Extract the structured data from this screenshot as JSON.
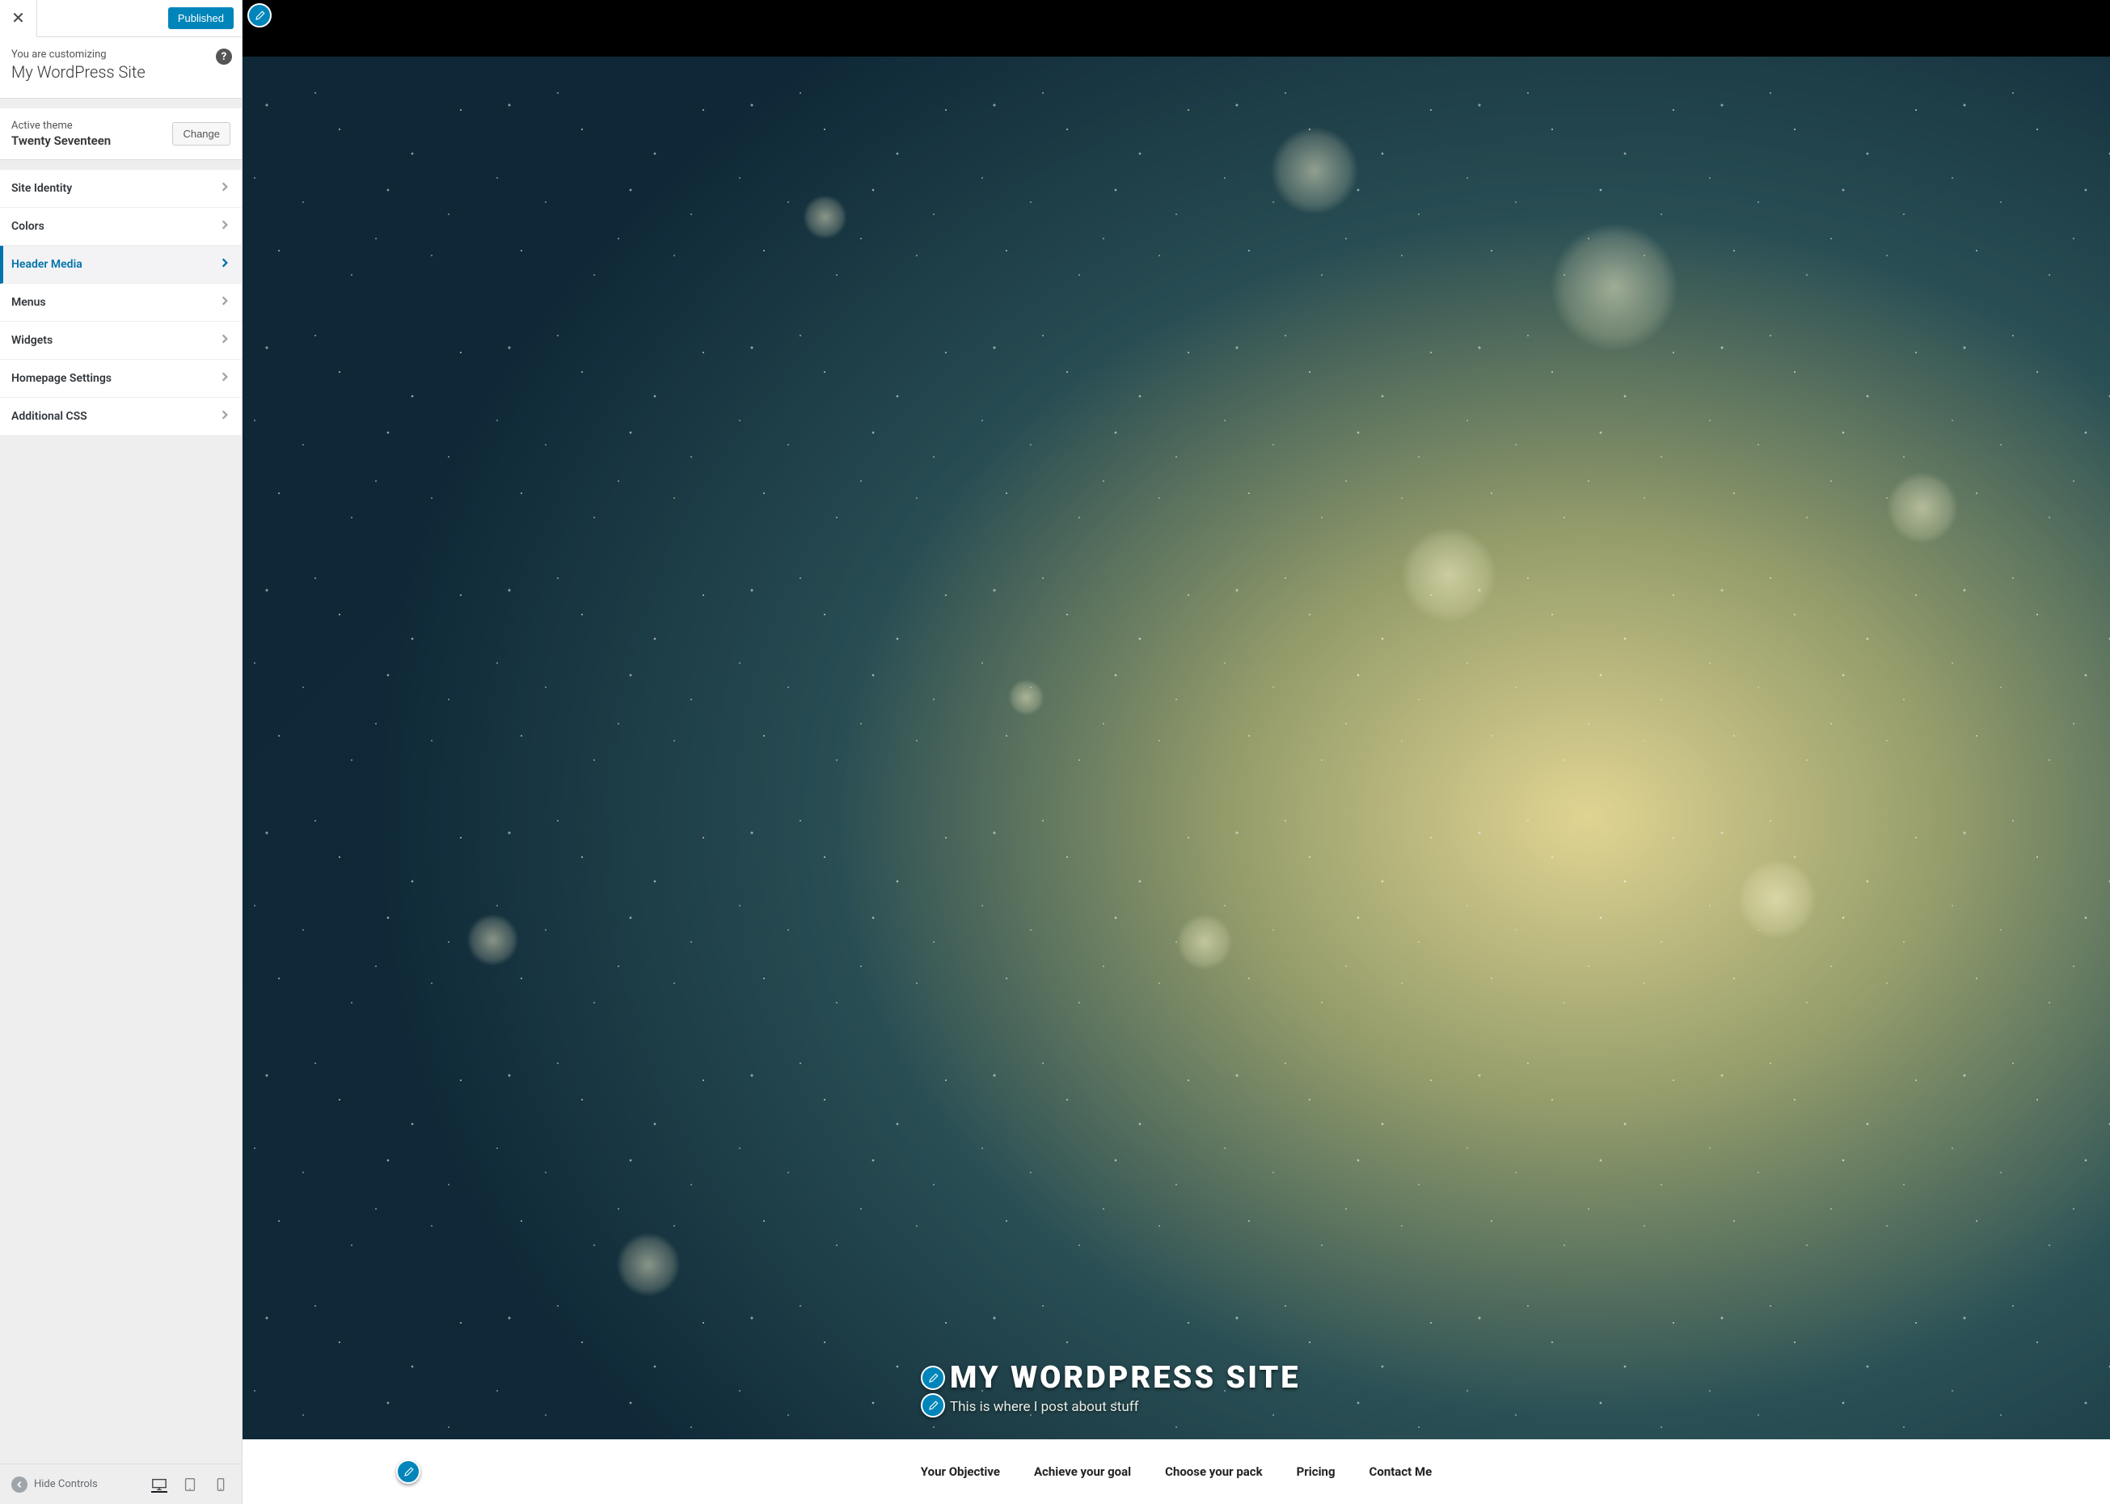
{
  "sidebar": {
    "publish_label": "Published",
    "intro_label": "You are customizing",
    "site_title": "My WordPress Site",
    "theme_label": "Active theme",
    "theme_name": "Twenty Seventeen",
    "change_label": "Change",
    "items": [
      {
        "label": "Site Identity"
      },
      {
        "label": "Colors"
      },
      {
        "label": "Header Media"
      },
      {
        "label": "Menus"
      },
      {
        "label": "Widgets"
      },
      {
        "label": "Homepage Settings"
      },
      {
        "label": "Additional CSS"
      }
    ],
    "active_index": 2,
    "hide_controls_label": "Hide Controls"
  },
  "preview": {
    "title": "MY WORDPRESS SITE",
    "tagline": "This is where I post about stuff",
    "nav": [
      "Your Objective",
      "Achieve your goal",
      "Choose your pack",
      "Pricing",
      "Contact Me"
    ]
  }
}
